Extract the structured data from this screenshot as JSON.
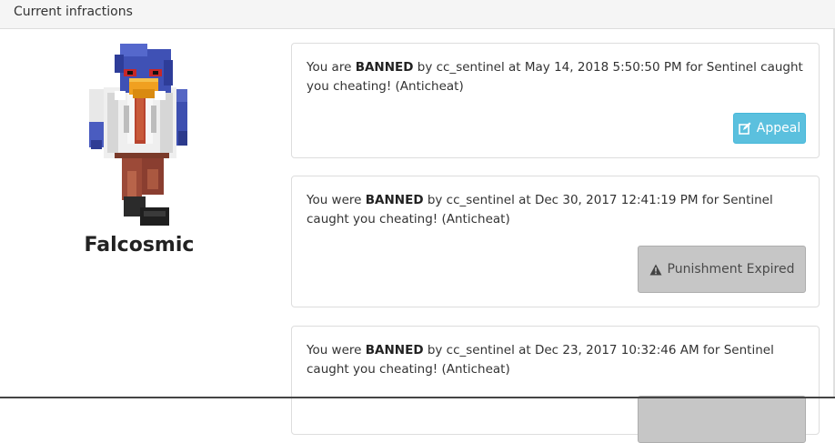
{
  "panel": {
    "title": "Current infractions"
  },
  "player": {
    "name": "Falcosmic",
    "avatar_icon": "falco-skin-avatar"
  },
  "infractions": [
    {
      "prefix": "You are ",
      "type": "BANNED",
      "details": " by cc_sentinel at May 14, 2018 5:50:50 PM for Sentinel caught you cheating! (Anticheat)",
      "action_label": "Appeal",
      "action_icon": "edit-icon"
    },
    {
      "prefix": "You were ",
      "type": "BANNED",
      "details": " by cc_sentinel at Dec 30, 2017 12:41:19 PM for Sentinel caught you cheating! (Anticheat)",
      "action_label": "Punishment Expired",
      "action_icon": "warning-icon"
    },
    {
      "prefix": "You were ",
      "type": "BANNED",
      "details": " by cc_sentinel at Dec 23, 2017 10:32:46 AM for Sentinel caught you cheating! (Anticheat)",
      "action_label": "",
      "action_icon": ""
    }
  ],
  "colors": {
    "appeal_button": "#5bc0de",
    "expired_button": "#c6c6c6"
  }
}
